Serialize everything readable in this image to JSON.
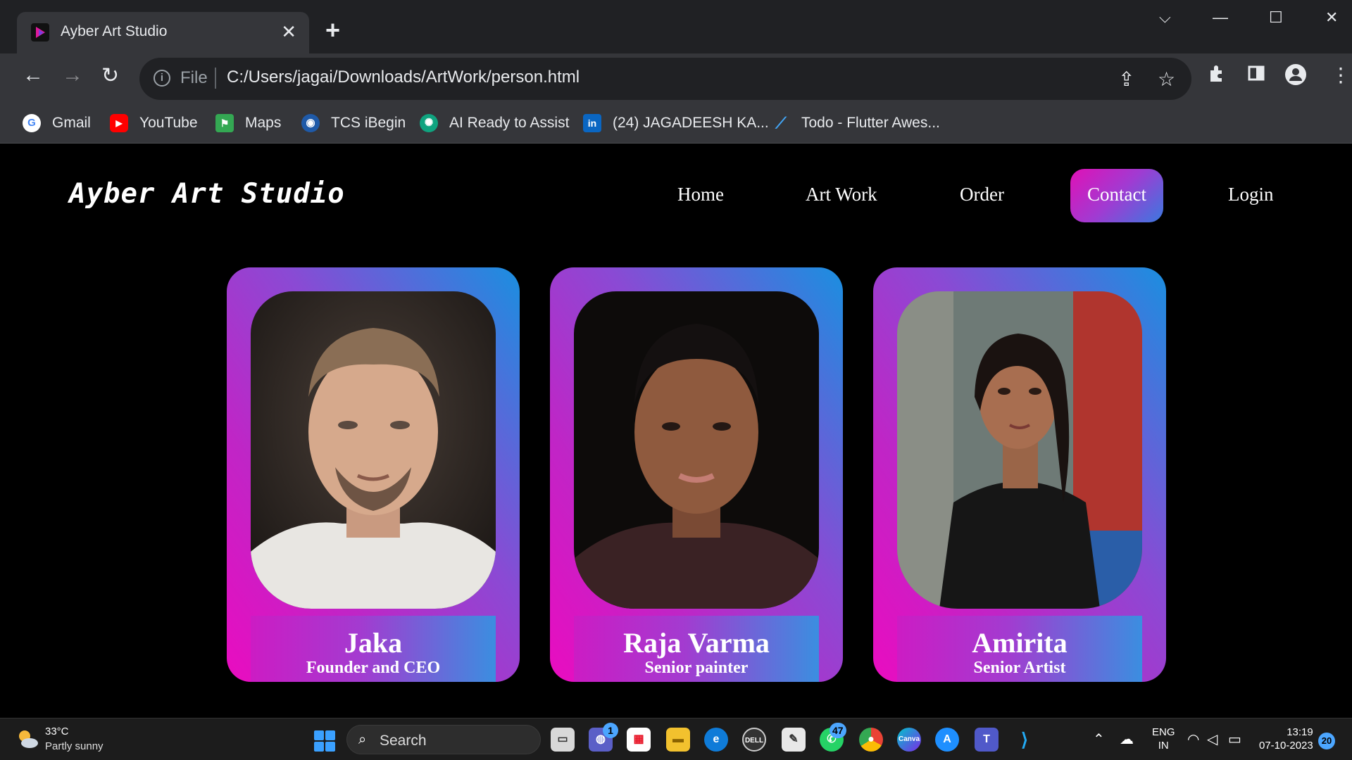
{
  "browser": {
    "tab_title": "Ayber Art Studio",
    "tab_close": "✕",
    "new_tab": "+",
    "window_controls": {
      "dropdown": "⌵",
      "minimize": "—",
      "maximize": "☐",
      "close": "✕"
    },
    "nav": {
      "back": "←",
      "forward": "→",
      "reload": "↻"
    },
    "omnibox": {
      "scheme_label": "File",
      "url": "C:/Users/jagai/Downloads/ArtWork/person.html"
    },
    "bookmarks": [
      {
        "label": "Gmail",
        "icon": "google-icon",
        "color": "#ffffff"
      },
      {
        "label": "YouTube",
        "icon": "youtube-icon",
        "color": "#ff0000"
      },
      {
        "label": "Maps",
        "icon": "maps-icon",
        "color": "#34a853"
      },
      {
        "label": "TCS iBegin",
        "icon": "tcs-icon",
        "color": "#1f5aa8"
      },
      {
        "label": "AI Ready to Assist",
        "icon": "chatgpt-icon",
        "color": "#10a37f"
      },
      {
        "label": "(24) JAGADEESH KA...",
        "icon": "linkedin-icon",
        "color": "#0a66c2"
      },
      {
        "label": "Todo - Flutter Awes...",
        "icon": "flutter-icon",
        "color": "#42a5f5"
      }
    ]
  },
  "site": {
    "brand": "Ayber Art Studio",
    "nav": {
      "home": "Home",
      "artwork": "Art Work",
      "order": "Order",
      "contact": "Contact",
      "login": "Login"
    },
    "accent_gradient": [
      "#ea0cc0",
      "#8a4ad4",
      "#1a8fe0"
    ],
    "people": [
      {
        "name": "Jaka",
        "role": "Founder and CEO"
      },
      {
        "name": "Raja Varma",
        "role": "Senior painter"
      },
      {
        "name": "Amirita",
        "role": "Senior Artist"
      }
    ]
  },
  "taskbar": {
    "weather": {
      "temp": "33°C",
      "desc": "Partly sunny"
    },
    "search_label": "Search",
    "badges": {
      "chat": "1",
      "whatsapp": "47"
    },
    "lang": {
      "line1": "ENG",
      "line2": "IN"
    },
    "clock": {
      "time": "13:19",
      "date": "07-10-2023"
    },
    "notifications": "20"
  }
}
